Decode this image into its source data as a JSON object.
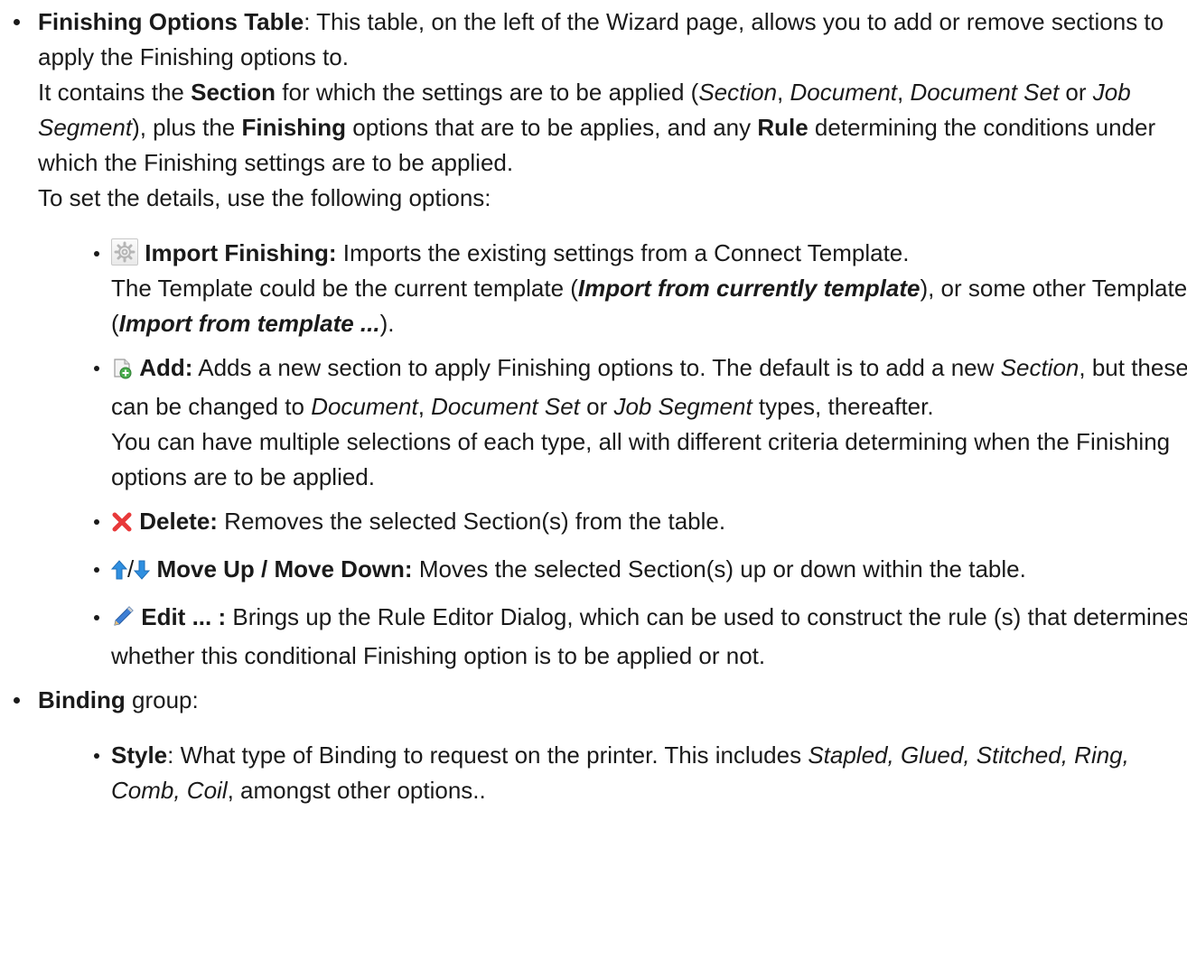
{
  "finishing": {
    "title": "Finishing Options Table",
    "desc": ": This table, on the left of the Wizard page, allows you to add or remove sections to apply the Finishing options to.",
    "p2_a": "It contains the ",
    "p2_section": "Section",
    "p2_b": " for which the settings are to be applied (",
    "p2_sec_i": "Section",
    "p2_c": ", ",
    "p2_doc_i": "Document",
    "p2_d": ", ",
    "p2_docset_i": "Document Set",
    "p2_e": " or ",
    "p2_jobseg_i": "Job Segment",
    "p2_f": "), plus the ",
    "p2_finishing": "Finishing",
    "p2_g": " options that are to be applies, and any ",
    "p2_rule": "Rule",
    "p2_h": " determining the conditions under which the Finishing settings are to be applied.",
    "p3": "To set the details, use the following options:"
  },
  "options": {
    "import": {
      "label": "Import Finishing:",
      "text": " Imports the existing settings from a Connect Template.",
      "l2_a": "The Template could be the current template (",
      "l2_bi": "Import from currently template",
      "l2_b": "), or some other Template (",
      "l2_bi2": "Import from template ...",
      "l2_c": ")."
    },
    "add": {
      "label": "Add:",
      "text_a": " Adds a new section to apply Finishing options to. The default is to add a new ",
      "sec_i": "Section",
      "text_b": ", but these can be changed to ",
      "doc_i": "Document",
      "text_c": ", ",
      "docset_i": "Document Set",
      "text_d": " or ",
      "jobseg_i": "Job Segment",
      "text_e": " types, thereafter.",
      "l2": "You can have multiple selections of each type, all with different criteria determining when the Finishing options are to be applied."
    },
    "delete": {
      "label": "Delete:",
      "text": " Removes the selected Section(s) from the table."
    },
    "move": {
      "sep": "/",
      "label": "Move Up / Move Down:",
      "text": " Moves the selected Section(s) up or down within the table."
    },
    "edit": {
      "label": "Edit ... :",
      "text": " Brings up the Rule Editor Dialog, which can be used to construct the rule (s) that determines whether this conditional Finishing option is to be applied or not."
    }
  },
  "binding": {
    "label": "Binding",
    "text": " group:",
    "style": {
      "label": "Style",
      "text_a": ": What type of Binding to request on the printer. This includes ",
      "types_i": "Stapled, Glued, Stitched, Ring, Comb, Coil",
      "text_b": ", amongst other options.."
    }
  },
  "colors": {
    "text": "#1a1a1a",
    "delete_icon": "#e8393a",
    "arrow_icon": "#2f8fe0"
  }
}
